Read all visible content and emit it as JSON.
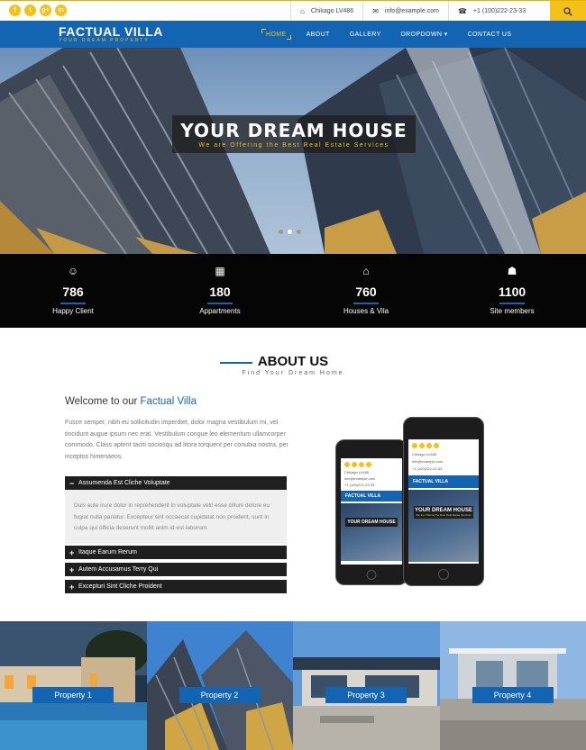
{
  "topbar": {
    "social": [
      {
        "icon": "facebook-icon",
        "glyph": "f"
      },
      {
        "icon": "twitter-icon",
        "glyph": "t"
      },
      {
        "icon": "google-plus-icon",
        "glyph": "g+"
      },
      {
        "icon": "linkedin-icon",
        "glyph": "in"
      }
    ],
    "address": "Chikago LV486",
    "email": "info@example.com",
    "phone": "+1 (100)222-23-33"
  },
  "nav": {
    "logo_title": "FACTUAL VILLA",
    "logo_tagline": "YOUR DREAM PROPERTY",
    "items": [
      {
        "label": "HOME",
        "active": true
      },
      {
        "label": "ABOUT"
      },
      {
        "label": "GALLERY"
      },
      {
        "label": "DROPDOWN ▾"
      },
      {
        "label": "CONTACT US"
      }
    ]
  },
  "hero": {
    "title": "YOUR DREAM HOUSE",
    "subtitle": "We are Offering the Best Real Estate Services",
    "slides": 3,
    "active_slide": 1
  },
  "stats": [
    {
      "icon": "smile-icon",
      "glyph": "☺",
      "value": "786",
      "label": "Happy Client"
    },
    {
      "icon": "building-icon",
      "glyph": "▦",
      "value": "180",
      "label": "Appartments"
    },
    {
      "icon": "home-icon",
      "glyph": "⌂",
      "value": "760",
      "label": "Houses & Vila"
    },
    {
      "icon": "users-icon",
      "glyph": "☗",
      "value": "1100",
      "label": "Site members"
    }
  ],
  "about": {
    "heading": "ABOUT US",
    "subheading": "Find Your Dream Home",
    "welcome_prefix": "Welcome to our",
    "welcome_highlight": "Factual Villa",
    "intro": "Fusce semper, nibh eu sollicitudin imperdiet, dolor magna vestibulum mi, vel tincidunt augue ipsum nec erat. Vestibulum congue leo elementum ullamcorper commodo. Class aptent taciti sociosqu ad litora torquent per conubia nostra, per inceptos himenaeos.",
    "accordion": [
      {
        "title": "Assumenda Est Cliche Voluptate",
        "open": true,
        "symbol": "−",
        "body": "Duis aute irure dolor in reprehenderit in voluptate velit esse cillum dolore eu fugiat nulla pariatur. Excepteur sint occaecat cupidatat non proident, sunt in culpa qui officia deserunt mollit anim id est laborum."
      },
      {
        "title": "Itaque Earum Rerum",
        "open": false,
        "symbol": "+"
      },
      {
        "title": "Autem Accusamus Terry Qui",
        "open": false,
        "symbol": "+"
      },
      {
        "title": "Excepturi Sint Cliche Proident",
        "open": false,
        "symbol": "+"
      }
    ],
    "phone_mockup": {
      "brand": "FACTUAL VILLA",
      "hero_title": "YOUR DREAM HOUSE",
      "hero_subtitle": "We are Offering the Best Real Estate Services",
      "address": "Chikago LV486",
      "email": "info@example.com",
      "phone": "+1 (100)222-23-33"
    }
  },
  "properties": [
    {
      "label": "Property 1"
    },
    {
      "label": "Property 2"
    },
    {
      "label": "Property 3"
    },
    {
      "label": "Property 4"
    }
  ],
  "colors": {
    "brand_blue": "#1464b4",
    "accent_yellow": "#f5c01a",
    "stats_bg": "#050505"
  }
}
